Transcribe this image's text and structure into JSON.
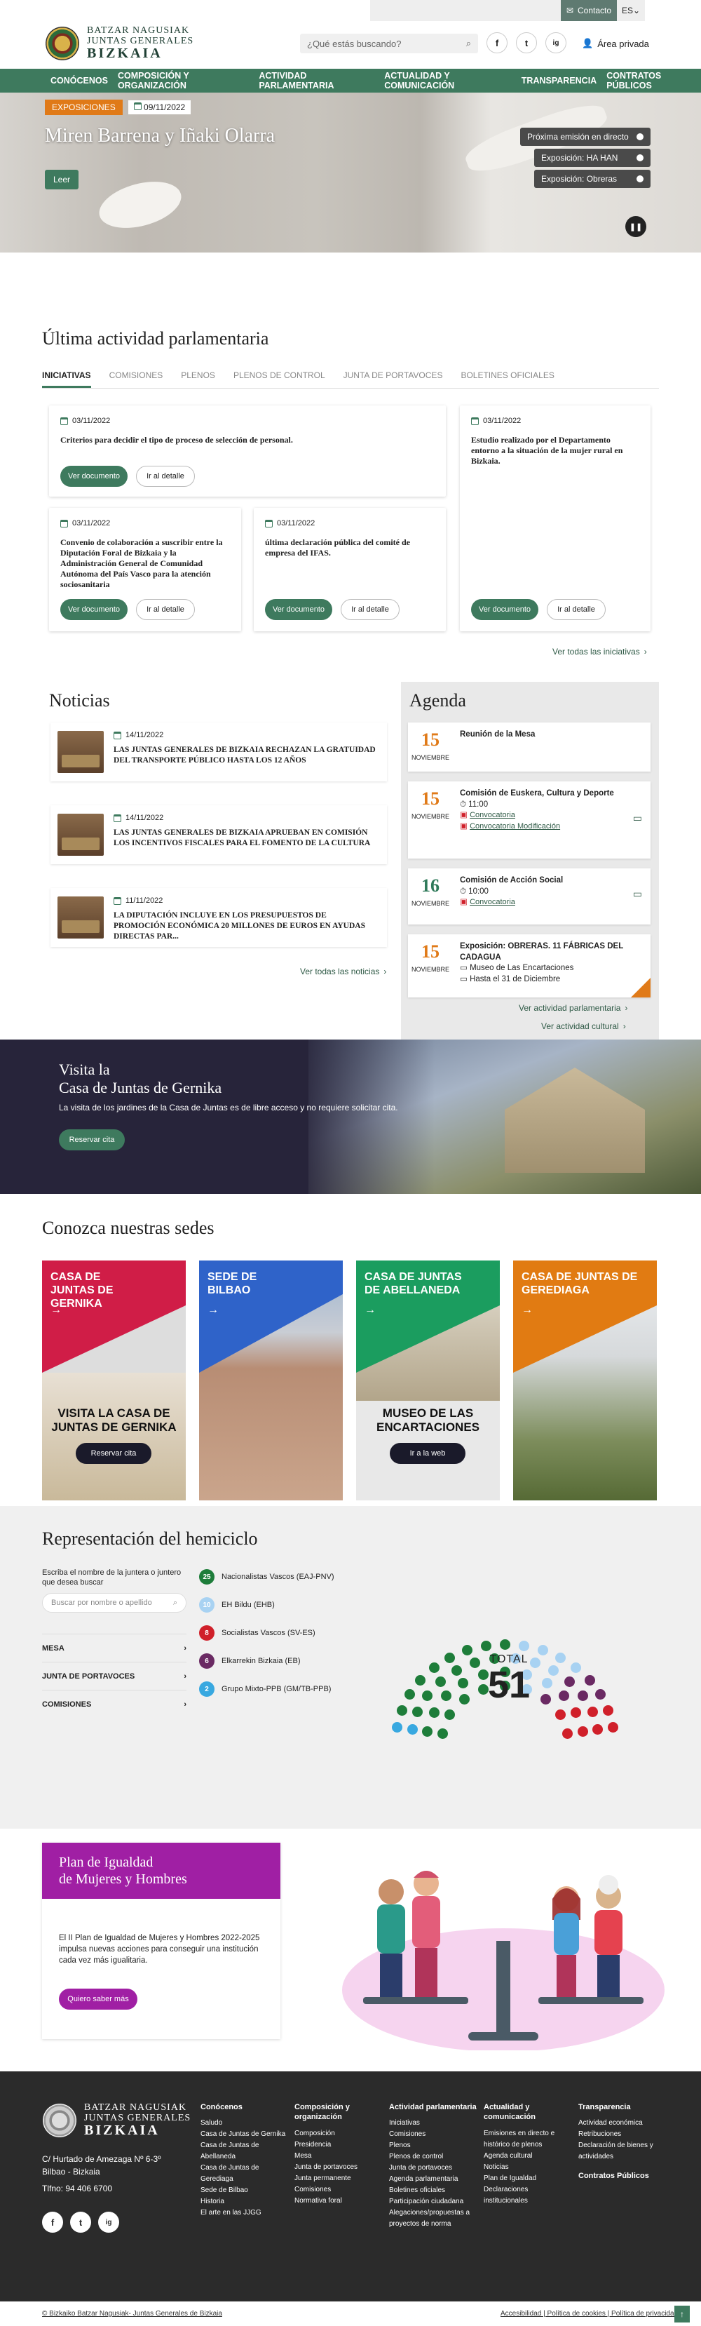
{
  "topbar": {
    "contact": "Contacto",
    "lang": "ES"
  },
  "header": {
    "logo_line1": "BATZAR NAGUSIAK",
    "logo_line2": "JUNTAS GENERALES",
    "logo_line3": "BIZKAIA",
    "search_placeholder": "¿Qué estás buscando?",
    "social": [
      "f",
      "t",
      "ig"
    ],
    "private": "Área privada"
  },
  "nav": [
    "CONÓCENOS",
    "COMPOSICIÓN Y ORGANIZACIÓN",
    "ACTIVIDAD PARLAMENTARIA",
    "ACTUALIDAD Y COMUNICACIÓN",
    "TRANSPARENCIA",
    "CONTRATOS PÚBLICOS"
  ],
  "hero": {
    "tag": "EXPOSICIONES",
    "date": "09/11/2022",
    "title": "Miren Barrena y Iñaki Olarra",
    "button": "Leer",
    "pills": [
      "Próxima emisión en directo",
      "Exposición: HA HAN",
      "Exposición: Obreras"
    ]
  },
  "activity": {
    "title": "Última actividad parlamentaria",
    "tabs": [
      "INICIATIVAS",
      "COMISIONES",
      "PLENOS",
      "PLENOS DE CONTROL",
      "JUNTA DE PORTAVOCES",
      "BOLETINES OFICIALES"
    ],
    "cards": [
      {
        "date": "03/11/2022",
        "text": "Criterios para decidir el tipo de proceso de selección de personal."
      },
      {
        "date": "03/11/2022",
        "text": "Estudio realizado por el Departamento entorno a la situación de la mujer rural en Bizkaia."
      },
      {
        "date": "03/11/2022",
        "text": "Convenio de colaboración a suscribir entre la Diputación Foral de Bizkaia y la Administración General de Comunidad Autónoma del País Vasco para la atención sociosanitaria"
      },
      {
        "date": "03/11/2022",
        "text": "última declaración pública del comité de empresa del IFAS."
      }
    ],
    "btn_doc": "Ver documento",
    "btn_detail": "Ir al detalle",
    "all": "Ver todas las iniciativas"
  },
  "news": {
    "title": "Noticias",
    "items": [
      {
        "date": "14/11/2022",
        "text": "LAS JUNTAS GENERALES DE BIZKAIA RECHAZAN LA GRATUIDAD DEL TRANSPORTE PÚBLICO HASTA LOS 12 AÑOS"
      },
      {
        "date": "14/11/2022",
        "text": "LAS JUNTAS GENERALES DE BIZKAIA APRUEBAN EN COMISIÓN LOS INCENTIVOS FISCALES PARA EL FOMENTO DE LA CULTURA"
      },
      {
        "date": "11/11/2022",
        "text": "LA DIPUTACIÓN INCLUYE EN LOS PRESUPUESTOS DE PROMOCIÓN ECONÓMICA 20 MILLONES DE EUROS EN AYUDAS DIRECTAS PAR..."
      }
    ],
    "all": "Ver todas las noticias"
  },
  "agenda": {
    "title": "Agenda",
    "items": [
      {
        "day": "15",
        "month": "NOVIEMBRE",
        "title": "Reunión de la Mesa",
        "time": "",
        "l1": "",
        "l2": ""
      },
      {
        "day": "15",
        "month": "NOVIEMBRE",
        "title": "Comisión de Euskera, Cultura y Deporte",
        "time": "11:00",
        "l1": "Convocatoria",
        "l2": "Convocatoria Modificación"
      },
      {
        "day": "16",
        "month": "NOVIEMBRE",
        "title": "Comisión de Acción Social",
        "time": "10:00",
        "l1": "Convocatoria",
        "l2": ""
      },
      {
        "day": "15",
        "month": "NOVIEMBRE",
        "title": "Exposición: OBRERAS. 11 FÁBRICAS DEL CADAGUA",
        "time": "",
        "l1": "Museo de Las Encartaciones",
        "l2": "Hasta el 31 de Diciembre"
      }
    ],
    "link1": "Ver actividad parlamentaria",
    "link2": "Ver actividad cultural"
  },
  "visit": {
    "title_1": "Visita la",
    "title_2": "Casa de Juntas de Gernika",
    "text": "La visita de los jardines de la Casa de Juntas es de libre acceso y no requiere solicitar cita.",
    "button": "Reservar cita"
  },
  "sedes": {
    "title": "Conozca nuestras sedes",
    "items": [
      {
        "title": "CASA DE JUNTAS DE GERNIKA",
        "caption": "VISITA LA CASA DE JUNTAS DE GERNIKA",
        "button": "Reservar cita",
        "color": "#d01d47"
      },
      {
        "title": "SEDE DE BILBAO",
        "caption": "",
        "button": "",
        "color": "#2f63c9"
      },
      {
        "title": "CASA DE JUNTAS DE ABELLANEDA",
        "caption": "MUSEO DE LAS ENCARTACIONES",
        "button": "Ir a la web",
        "color": "#1b9d5f"
      },
      {
        "title": "CASA DE JUNTAS DE GEREDIAGA",
        "caption": "",
        "button": "",
        "color": "#e17b12"
      }
    ]
  },
  "hemiciclo": {
    "title": "Representación del hemiciclo",
    "label": "Escriba el nombre de la juntera o juntero que desea buscar",
    "placeholder": "Buscar por nombre o apellido",
    "accordions": [
      "MESA",
      "JUNTA DE PORTAVOCES",
      "COMISIONES"
    ],
    "parties": [
      {
        "seats": "25",
        "name": "Nacionalistas Vascos (EAJ-PNV)",
        "color": "#1e7d3a"
      },
      {
        "seats": "10",
        "name": "EH Bildu (EHB)",
        "color": "#a8d2f2"
      },
      {
        "seats": "8",
        "name": "Socialistas Vascos (SV-ES)",
        "color": "#d0202a"
      },
      {
        "seats": "6",
        "name": "Elkarrekin Bizkaia (EB)",
        "color": "#6a2a63"
      },
      {
        "seats": "2",
        "name": "Grupo Mixto-PPB (GM/TB-PPB)",
        "color": "#38a8e0"
      }
    ],
    "total_label": "TOTAL",
    "total": "51"
  },
  "plan": {
    "title_1": "Plan de Igualdad",
    "title_2": "de Mujeres y Hombres",
    "text": "El II Plan de Igualdad de Mujeres y Hombres 2022-2025 impulsa nuevas acciones para conseguir una institución cada vez más igualitaria.",
    "button": "Quiero saber más"
  },
  "footer": {
    "address_1": "C/ Hurtado de Amezaga Nº 6-3º",
    "address_2": "Bilbao - Bizkaia",
    "phone": "Tlfno: 94 406 6700",
    "cols": [
      {
        "title": "Conócenos",
        "items": [
          "Saludo",
          "Casa de Juntas de Gernika",
          "Casa de Juntas de Abellaneda",
          "Casa de Juntas de Gerediaga",
          "Sede de Bilbao",
          "Historia",
          "El arte en las JJGG"
        ]
      },
      {
        "title": "Composición y organización",
        "items": [
          "Composición",
          "Presidencia",
          "Mesa",
          "Junta de portavoces",
          "Junta permanente",
          "Comisiones",
          "Normativa foral"
        ]
      },
      {
        "title": "Actividad parlamentaria",
        "items": [
          "Iniciativas",
          "Comisiones",
          "Plenos",
          "Plenos de control",
          "Junta de portavoces",
          "Agenda parlamentaria",
          "Boletines oficiales",
          "Participación ciudadana",
          "Alegaciones/propuestas a proyectos de norma"
        ]
      },
      {
        "title": "Actualidad y comunicación",
        "items": [
          "Emisiones en directo e histórico de plenos",
          "Agenda cultural",
          "Noticias",
          "Plan de Igualdad",
          "Declaraciones institucionales"
        ]
      },
      {
        "title": "Transparencia",
        "items": [
          "Actividad económica",
          "Retribuciones",
          "Declaración de bienes y actividades"
        ]
      }
    ],
    "contracts": "Contratos Públicos",
    "copyright": "© Bizkaiko Batzar Nagusiak- Juntas Generales de Bizkaia",
    "links": "Accesibilidad | Política de cookies | Política de privacidad"
  }
}
